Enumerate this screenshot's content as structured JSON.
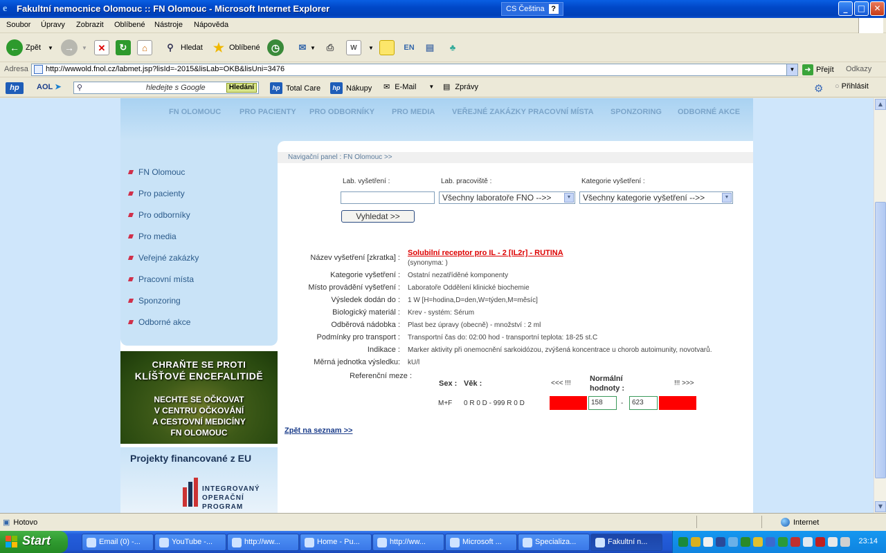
{
  "window": {
    "title": "Fakultní nemocnice Olomouc :: FN Olomouc - Microsoft Internet Explorer",
    "language": "CS Čeština",
    "help": "?",
    "min": "_",
    "max": "□",
    "close": "✕"
  },
  "menu": [
    "Soubor",
    "Úpravy",
    "Zobrazit",
    "Oblíbené",
    "Nástroje",
    "Nápověda"
  ],
  "toolbar": {
    "back": "Zpět",
    "search": "Hledat",
    "favorites": "Oblíbené"
  },
  "address": {
    "label": "Adresa",
    "url": "http://wwwold.fnol.cz/labmet.jsp?lisId=-2015&lisLab=OKB&lisUni=3476",
    "go": "Přejít",
    "links": "Odkazy"
  },
  "linksbar": {
    "hp": "hp",
    "aol": "AOL",
    "search_placeholder": "hledejte s Google",
    "search_button": "Hledání",
    "total_care": "Total Care",
    "nakupy": "Nákupy",
    "email": "E-Mail",
    "zpravy": "Zprávy",
    "login": "Přihlásit"
  },
  "site": {
    "topnav": [
      "FN OLOMOUC",
      "PRO PACIENTY",
      "PRO ODBORNÍKY",
      "PRO MEDIA",
      "VEŘEJNÉ ZAKÁZKY",
      "PRACOVNÍ MÍSTA",
      "SPONZORING",
      "ODBORNÉ AKCE"
    ],
    "leftmenu": [
      "FN Olomouc",
      "Pro pacienty",
      "Pro odborníky",
      "Pro media",
      "Veřejné zakázky",
      "Pracovní místa",
      "Sponzoring",
      "Odborné akce"
    ],
    "banner1": {
      "line1": "CHRAŇTE SE PROTI",
      "line2": "KLÍŠŤOVÉ ENCEFALITIDĚ",
      "line3": "NECHTE SE OČKOVAT",
      "line4": "V CENTRU OČKOVÁNÍ",
      "line5": "A CESTOVNÍ MEDICÍNY",
      "line6": "FN OLOMOUC"
    },
    "banner2": {
      "title": "Projekty financované z EU",
      "l1": "INTEGROVANÝ",
      "l2": "OPERAČNÍ",
      "l3": "PROGRAM"
    },
    "breadcrumb": "Navigační panel : FN Olomouc >>"
  },
  "form": {
    "lab_test_label": "Lab. vyšetření :",
    "lab_dept_label": "Lab. pracoviště :",
    "category_label": "Kategorie vyšetření :",
    "lab_dept_value": "Všechny laboratoře FNO -->>",
    "category_value": "Všechny kategorie vyšetření -->>",
    "search_button": "Vyhledat >>"
  },
  "detail": {
    "name_label": "Název vyšetření [zkratka] :",
    "name_value": "Solubilní receptor pro IL - 2 [IL2r] - RUTINA",
    "synonyms": "(synonyma: )",
    "category_label": "Kategorie vyšetření :",
    "category_value": "Ostatní nezatříděné komponenty",
    "place_label": "Místo provádění vyšetření :",
    "place_value": "Laboratoře Oddělení klinické biochemie",
    "result_label": "Výsledek dodán do :",
    "result_value": "1 W [H=hodina,D=den,W=týden,M=měsíc]",
    "material_label": "Biologický materiál :",
    "material_value": "Krev - systém: Sérum",
    "container_label": "Odběrová nádobka :",
    "container_value": "Plast bez úpravy (obecně) - množství : 2 ml",
    "transport_label": "Podmínky pro transport :",
    "transport_value": "Transportní čas do: 02:00 hod - transportní teplota: 18-25 st.C",
    "indication_label": "Indikace :",
    "indication_value": "Marker aktivity při onemocnění sarkoidózou, zvýšená koncentrace u chorob autoimunity, novotvarů.",
    "unit_label": "Měrná jednotka výsledku:",
    "unit_value": "kU/l",
    "ref_label": "Referenční meze :",
    "ref": {
      "sex_h": "Sex :",
      "age_h": "Věk :",
      "low_h": "<<< !!!",
      "normal_h1": "Normální",
      "normal_h2": "hodnoty :",
      "high_h": "!!! >>>",
      "sex": "M+F",
      "age": "0 R 0 D - 999 R 0 D",
      "min": "158",
      "dash": "-",
      "max": "623"
    },
    "back_link": "Zpět na seznam >>"
  },
  "status": {
    "left": "Hotovo",
    "zone": "Internet"
  },
  "taskbar": {
    "start": "Start",
    "tasks": [
      "Email (0) -...",
      "YouTube -...",
      "http://ww...",
      "Home - Pu...",
      "http://ww...",
      "Microsoft ...",
      "Specializa...",
      "Fakultní n..."
    ],
    "clock": "23:14"
  }
}
